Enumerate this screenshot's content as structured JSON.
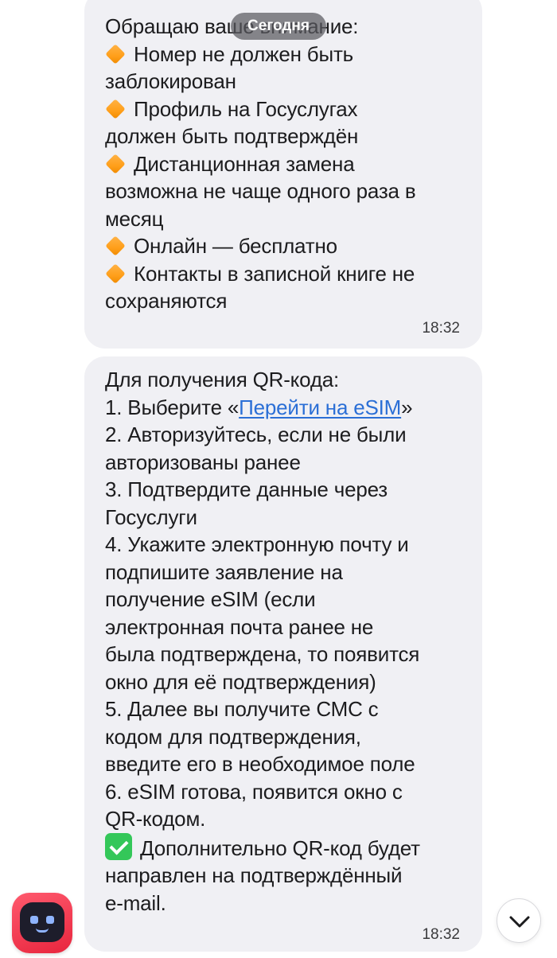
{
  "date_separator": "Сегодня",
  "message_1": {
    "lines": [
      {
        "type": "text",
        "text": "Обращаю ваше внимание:"
      },
      {
        "type": "bullet",
        "text": "Номер не должен быть"
      },
      {
        "type": "text",
        "text": "заблокирован"
      },
      {
        "type": "bullet",
        "text": "Профиль на Госуслугах"
      },
      {
        "type": "text",
        "text": "должен быть подтверждён"
      },
      {
        "type": "bullet",
        "text": "Дистанционная замена"
      },
      {
        "type": "text",
        "text": "возможна не чаще одного раза в"
      },
      {
        "type": "text",
        "text": "месяц"
      },
      {
        "type": "bullet",
        "text": "Онлайн — бесплатно"
      },
      {
        "type": "bullet",
        "text": "Контакты в записной книге не"
      },
      {
        "type": "text",
        "text": "сохраняются"
      }
    ],
    "time": "18:32"
  },
  "message_2": {
    "intro": "Для получения QR-кода:",
    "step1_prefix": "1. Выберите «",
    "step1_link": "Перейти на eSIM",
    "step1_suffix": "»",
    "lines": [
      "2. Авторизуйтесь, если не были",
      "авторизованы ранее",
      "3. Подтвердите данные через",
      "Госуслуги",
      "4. Укажите электронную почту и",
      "подпишите заявление на",
      "получение eSIM (если",
      "электронная почта ранее не",
      "была подтверждена, то появится",
      "окно для её подтверждения)",
      "5. Далее вы получите СМС с",
      "кодом для подтверждения,",
      "введите его в необходимое поле",
      "6. eSIM готова, появится окно с",
      "QR-кодом."
    ],
    "note_line1": "Дополнительно QR-код будет",
    "note_line2": "направлен на подтверждённый",
    "note_line3": "e-mail.",
    "time": "18:32"
  },
  "icons": {
    "bullet": "orange-diamond-icon",
    "check": "green-check-icon",
    "bot": "robot-avatar-icon",
    "scroll": "chevron-down-icon"
  },
  "colors": {
    "bubble": "#f0f0f4",
    "link": "#2b6fd6",
    "avatar": "#e8253d",
    "check": "#34c759",
    "bullet": "#ff9f1a"
  }
}
